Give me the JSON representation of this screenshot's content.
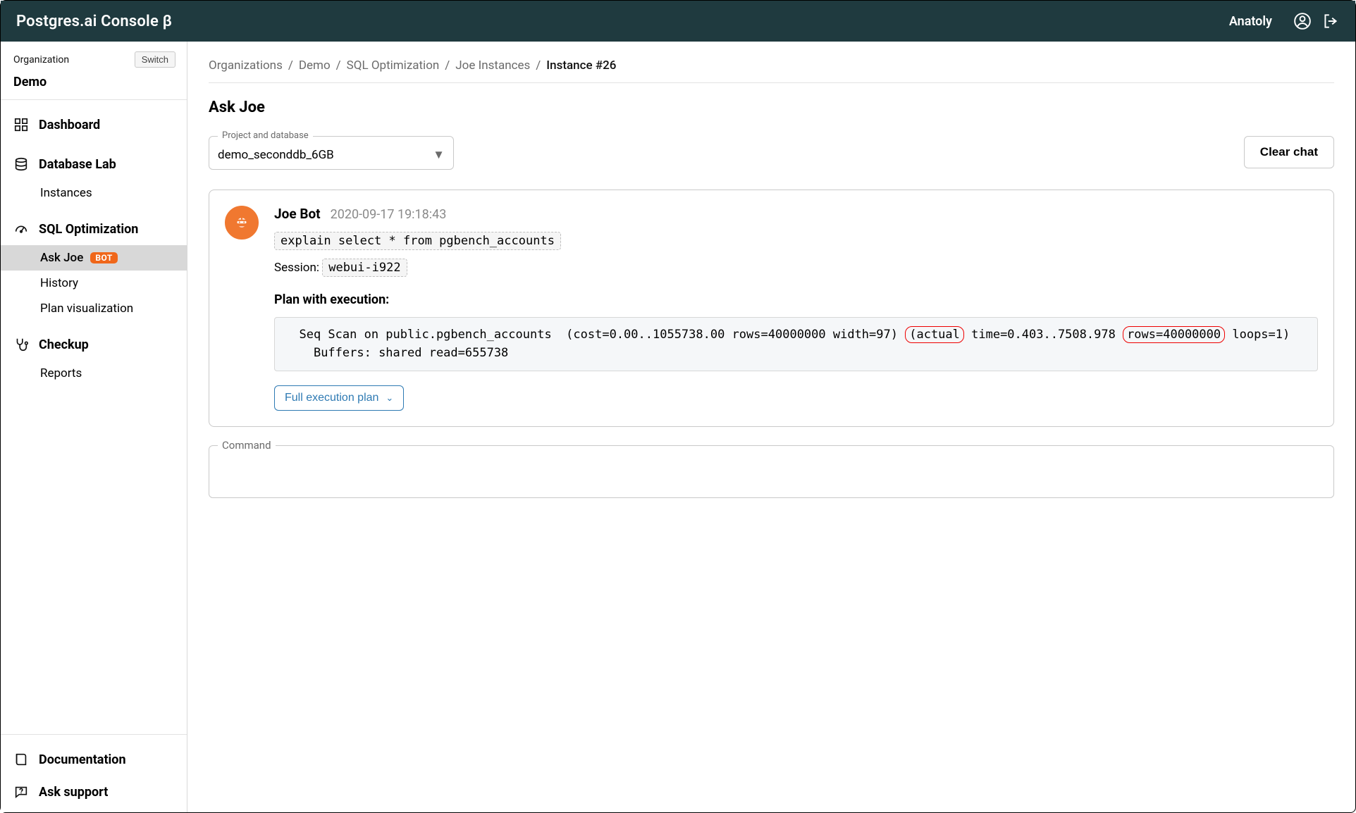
{
  "header": {
    "brand": "Postgres.ai Console β",
    "user": "Anatoly"
  },
  "sidebar": {
    "org_label": "Organization",
    "switch_label": "Switch",
    "org_name": "Demo",
    "groups": [
      {
        "title": "Dashboard",
        "icon": "dashboard"
      },
      {
        "title": "Database Lab",
        "icon": "dblab",
        "items": [
          "Instances"
        ]
      },
      {
        "title": "SQL Optimization",
        "icon": "sqlopt",
        "items": [
          "Ask Joe",
          "History",
          "Plan visualization"
        ],
        "active_item": "Ask Joe",
        "badge": "BOT"
      },
      {
        "title": "Checkup",
        "icon": "checkup",
        "items": [
          "Reports"
        ]
      }
    ],
    "footer": [
      {
        "title": "Documentation",
        "icon": "doc"
      },
      {
        "title": "Ask support",
        "icon": "support"
      }
    ]
  },
  "breadcrumb": [
    "Organizations",
    "Demo",
    "SQL Optimization",
    "Joe Instances",
    "Instance #26"
  ],
  "page_title": "Ask Joe",
  "toolbar": {
    "select_legend": "Project and database",
    "select_value": "demo_seconddb_6GB",
    "clear_label": "Clear chat"
  },
  "message": {
    "bot_name": "Joe Bot",
    "timestamp": "2020-09-17 19:18:43",
    "query": "explain select * from pgbench_accounts",
    "session_label": "Session:",
    "session_value": "webui-i922",
    "plan_title": "Plan with execution:",
    "plan_pre": "  Seq Scan on public.pgbench_accounts  (cost=0.00..1055738.00 rows=40000000 width=97)",
    "plan_hl1": "(actual",
    "plan_mid": " time=0.403..7508.978 ",
    "plan_hl2": "rows=40000000",
    "plan_post": " loops=1)",
    "plan_line2": "    Buffers: shared read=655738",
    "full_plan_label": "Full execution plan"
  },
  "command": {
    "legend": "Command",
    "value": ""
  }
}
